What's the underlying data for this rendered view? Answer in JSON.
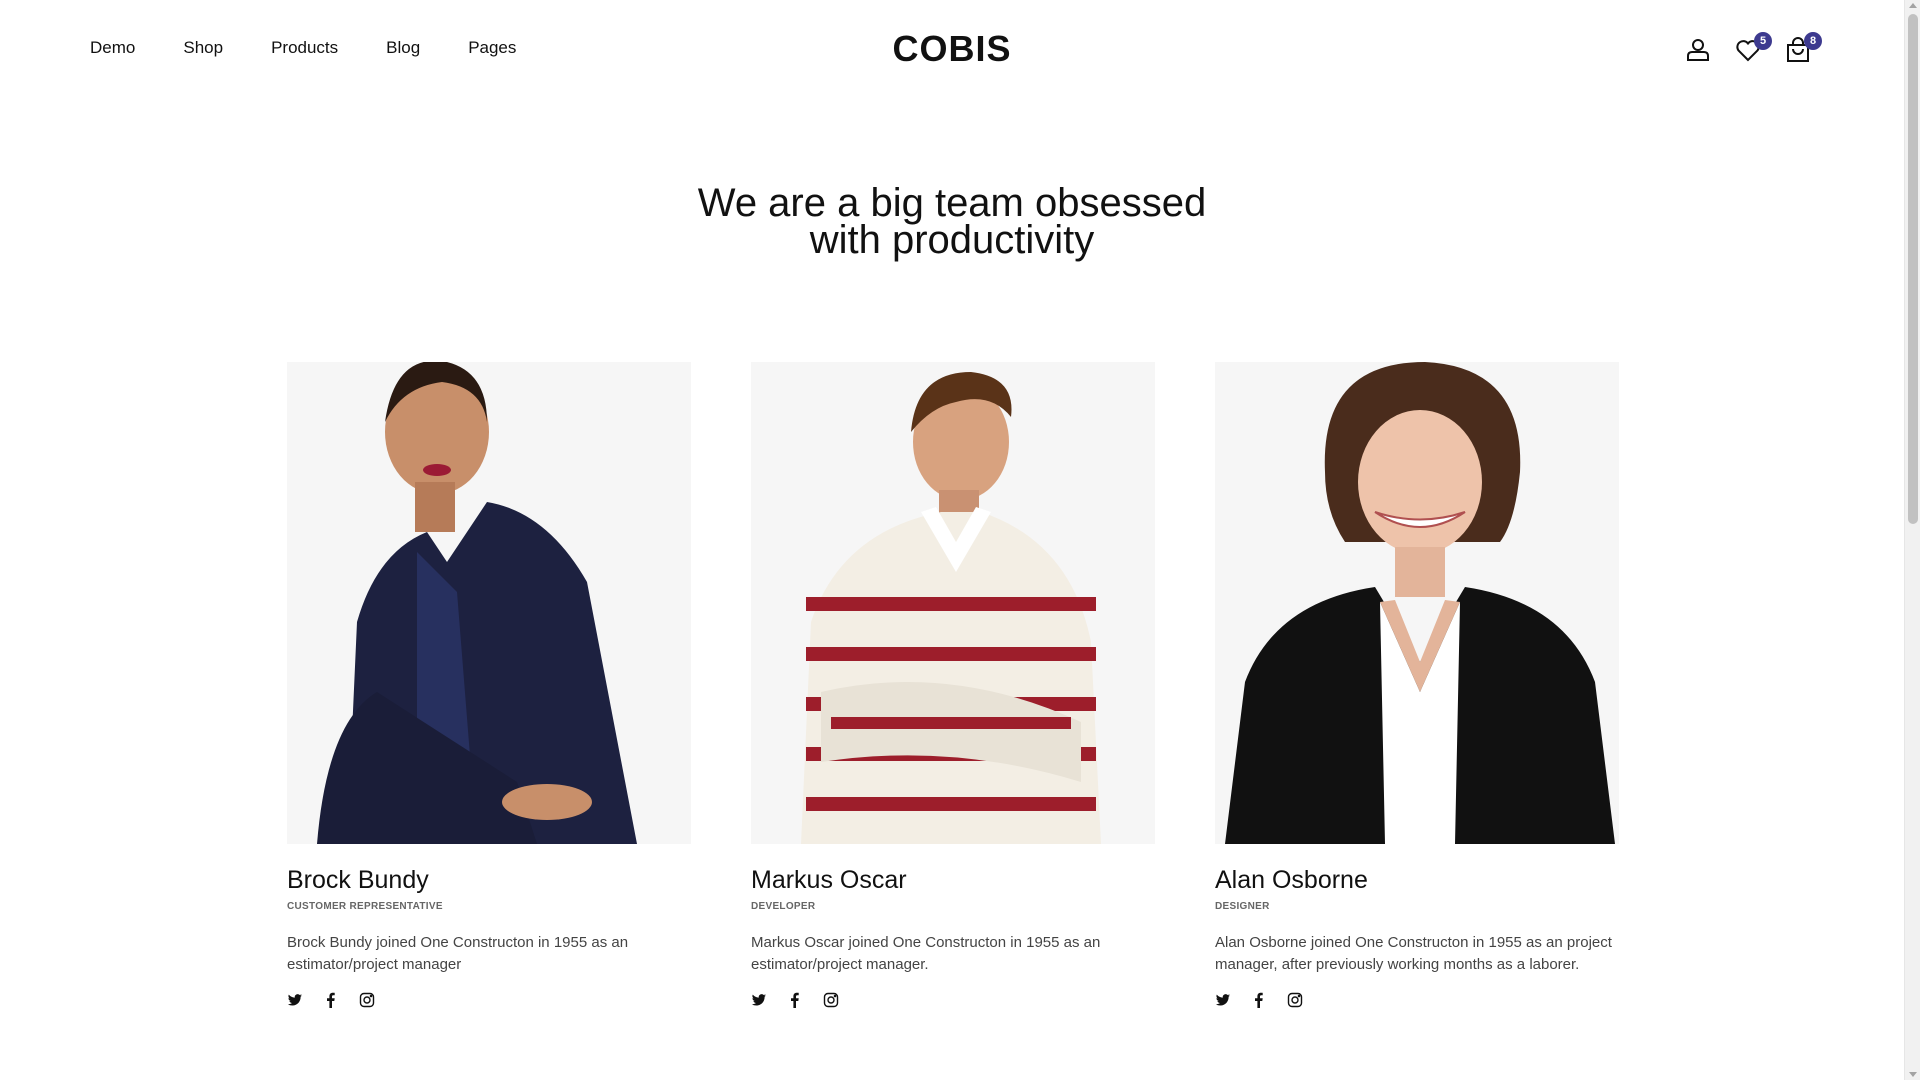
{
  "header": {
    "logo": "COBIS",
    "nav": [
      "Demo",
      "Shop",
      "Products",
      "Blog",
      "Pages"
    ],
    "icons": {
      "account": "user-icon",
      "wishlist": "heart-icon",
      "cart": "shopping-bag-icon"
    },
    "wishlist_count": "5",
    "cart_count": "8"
  },
  "hero": {
    "line1": "We are a big team obsessed",
    "line2": "with productivity"
  },
  "team": [
    {
      "name": "Brock Bundy",
      "role": "CUSTOMER REPRESENTATIVE",
      "bio": "Brock Bundy joined One Constructon in 1955 as an estimator/project manager"
    },
    {
      "name": "Markus Oscar",
      "role": "DEVELOPER",
      "bio": "Markus Oscar joined One Constructon in 1955 as an estimator/project manager."
    },
    {
      "name": "Alan Osborne",
      "role": "DESIGNER",
      "bio": "Alan Osborne joined One Constructon in 1955 as an project manager, after previously working months as a laborer."
    }
  ],
  "social_icons": [
    "twitter-icon",
    "facebook-icon",
    "instagram-icon"
  ],
  "colors": {
    "badge": "#3d3a8f",
    "text": "#111111",
    "muted": "#666666"
  }
}
